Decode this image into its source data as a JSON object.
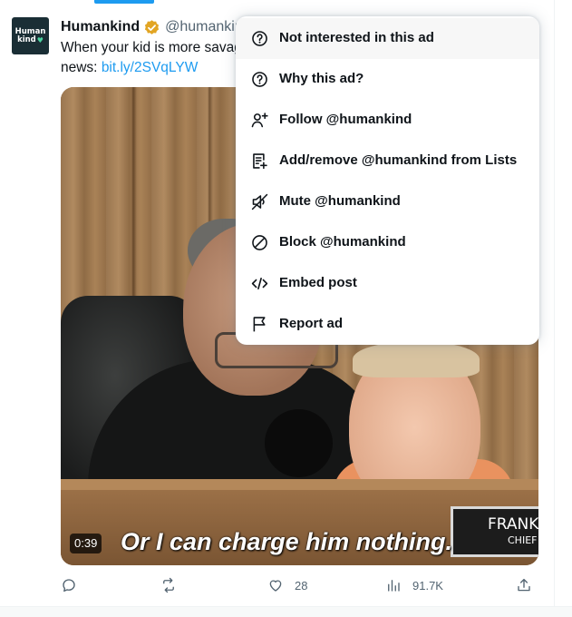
{
  "tweet": {
    "avatar": {
      "line1": "Human",
      "line2": "kind"
    },
    "author_name": "Humankind",
    "author_handle": "@humankin",
    "text_line1": "When your kid is more savag",
    "text_line2_prefix": "news: ",
    "link": "bit.ly/2SVqLYW"
  },
  "media": {
    "subtitle": "Or I can charge him nothing.",
    "duration": "0:39",
    "nameplate_line1": "FRANK",
    "nameplate_line2": "CHIEF"
  },
  "actions": {
    "reply": {
      "icon": "reply-icon",
      "count": ""
    },
    "repost": {
      "icon": "repost-icon",
      "count": ""
    },
    "like": {
      "icon": "heart-icon",
      "count": "28"
    },
    "views": {
      "icon": "analytics-icon",
      "count": "91.7K"
    },
    "share": {
      "icon": "share-icon",
      "count": ""
    }
  },
  "menu": {
    "items": [
      {
        "label": "Not interested in this ad",
        "icon": "question-circle-icon"
      },
      {
        "label": "Why this ad?",
        "icon": "question-circle-icon"
      },
      {
        "label": "Follow @humankind",
        "icon": "follow-user-icon"
      },
      {
        "label": "Add/remove @humankind from Lists",
        "icon": "list-add-icon"
      },
      {
        "label": "Mute @humankind",
        "icon": "mute-icon"
      },
      {
        "label": "Block @humankind",
        "icon": "block-icon"
      },
      {
        "label": "Embed post",
        "icon": "embed-code-icon"
      },
      {
        "label": "Report ad",
        "icon": "flag-icon"
      }
    ]
  },
  "colors": {
    "accent": "#1d9bf0",
    "text": "#0f1419",
    "muted": "#536471",
    "verified_badge": "#e2a523"
  }
}
